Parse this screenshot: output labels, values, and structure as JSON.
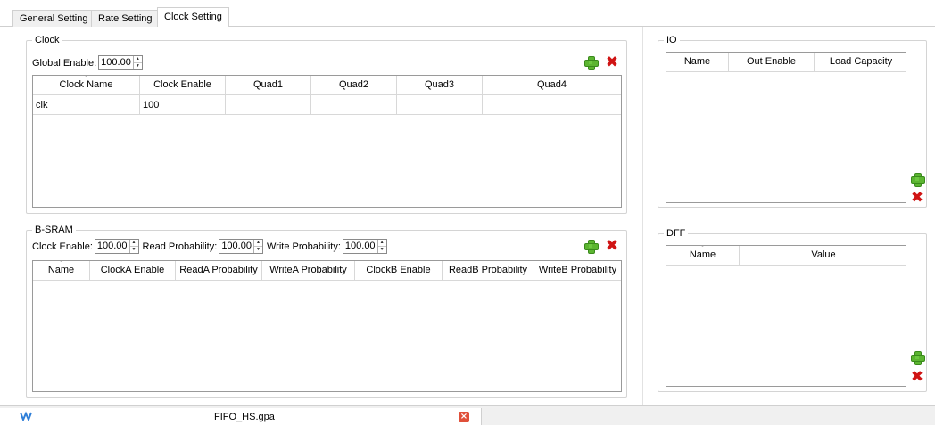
{
  "tabs": [
    {
      "label": "General Setting"
    },
    {
      "label": "Rate Setting"
    },
    {
      "label": "Clock Setting"
    }
  ],
  "clock": {
    "title": "Clock",
    "global_enable_label": "Global Enable:",
    "global_enable_value": "100.00",
    "columns": [
      "Clock Name",
      "Clock Enable",
      "Quad1",
      "Quad2",
      "Quad3",
      "Quad4"
    ],
    "rows": [
      [
        "clk",
        "100",
        "",
        "",
        "",
        ""
      ]
    ]
  },
  "bsram": {
    "title": "B-SRAM",
    "clock_enable_label": "Clock Enable:",
    "clock_enable_value": "100.00",
    "read_prob_label": "Read Probability:",
    "read_prob_value": "100.00",
    "write_prob_label": "Write Probability:",
    "write_prob_value": "100.00",
    "columns": [
      "Name",
      "ClockA Enable",
      "ReadA Probability",
      "WriteA Probability",
      "ClockB Enable",
      "ReadB Probability",
      "WriteB Probability"
    ]
  },
  "io": {
    "title": "IO",
    "columns": [
      "Name",
      "Out Enable",
      "Load Capacity"
    ]
  },
  "dff": {
    "title": "DFF",
    "columns": [
      "Name",
      "Value"
    ]
  },
  "statusbar": {
    "file_name": "FIFO_HS.gpa",
    "close_glyph": "×"
  },
  "icons": {
    "add": "plus-icon",
    "delete": "delete-x-icon",
    "spin_up": "▲",
    "spin_down": "▼",
    "delete_glyph": "✖"
  },
  "colors": {
    "add_green": "#5cb531",
    "delete_red": "#d01414",
    "close_orange": "#e0503a",
    "app_blue": "#2f7fd8"
  }
}
